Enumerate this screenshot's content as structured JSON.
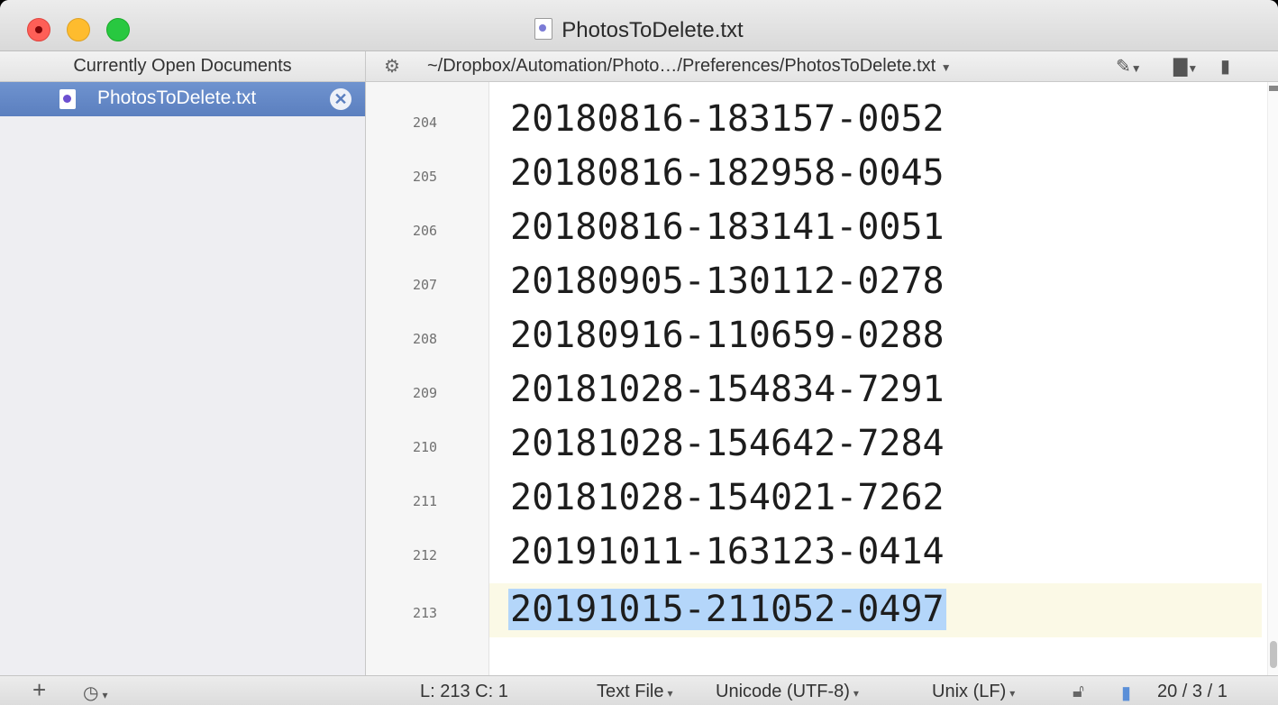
{
  "window": {
    "title": "PhotosToDelete.txt"
  },
  "sidebar": {
    "header": "Currently Open Documents",
    "items": [
      {
        "label": "PhotosToDelete.txt"
      }
    ]
  },
  "pathbar": {
    "path": "~/Dropbox/Automation/Photo…/Preferences/PhotosToDelete.txt"
  },
  "editor": {
    "lines": [
      {
        "num": "204",
        "text": "20180816-183157-0052"
      },
      {
        "num": "205",
        "text": "20180816-182958-0045"
      },
      {
        "num": "206",
        "text": "20180816-183141-0051"
      },
      {
        "num": "207",
        "text": "20180905-130112-0278"
      },
      {
        "num": "208",
        "text": "20180916-110659-0288"
      },
      {
        "num": "209",
        "text": "20181028-154834-7291"
      },
      {
        "num": "210",
        "text": "20181028-154642-7284"
      },
      {
        "num": "211",
        "text": "20181028-154021-7262"
      },
      {
        "num": "212",
        "text": "20191011-163123-0414"
      },
      {
        "num": "213",
        "text": "20191015-211052-0497"
      }
    ],
    "current_line": "213",
    "selection_color": "#b4d6fa"
  },
  "status": {
    "add": "+",
    "position": "L: 213 C: 1",
    "file_type": "Text File",
    "encoding": "Unicode (UTF-8)",
    "line_endings": "Unix (LF)",
    "counts": "20 / 3 / 1"
  }
}
